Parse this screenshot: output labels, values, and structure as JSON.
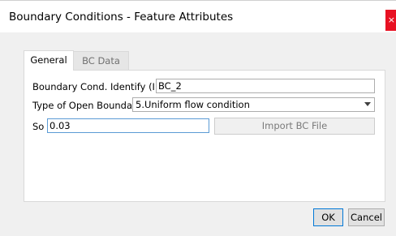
{
  "window": {
    "title": "Boundary Conditions - Feature Attributes",
    "close_symbol": "×",
    "close_color": "#e81123"
  },
  "tabs": [
    {
      "label": "General",
      "active": true
    },
    {
      "label": "BC Data",
      "active": false
    }
  ],
  "general": {
    "id_label": "Boundary Cond. Identify (ID)",
    "id_value": "BC_2",
    "type_label": "Type of Open Boundary",
    "type_value": "5.Uniform flow condition",
    "so_label": "So",
    "so_value": "0.03",
    "import_label": "Import BC File"
  },
  "buttons": {
    "ok": "OK",
    "cancel": "Cancel"
  },
  "colors": {
    "focus_border": "#5b9bd5",
    "default_button_border": "#0078d7"
  },
  "icons": {
    "close": "close-icon",
    "dropdown": "chevron-down-icon"
  }
}
